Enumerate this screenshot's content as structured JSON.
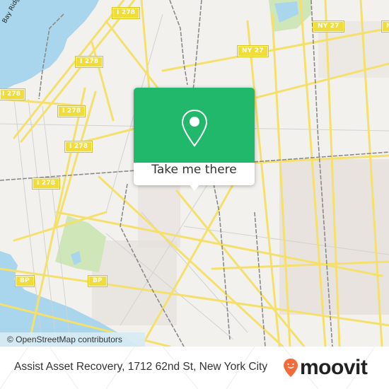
{
  "map": {
    "water_label": "Bay Ridge Channel",
    "shields": [
      {
        "label": "I 278"
      },
      {
        "label": "I 278"
      },
      {
        "label": "I 278"
      },
      {
        "label": "I 278"
      },
      {
        "label": "I 278"
      },
      {
        "label": "I 278"
      },
      {
        "label": "NY 27"
      },
      {
        "label": "NY 27"
      },
      {
        "label": "NY"
      },
      {
        "label": "BP"
      },
      {
        "label": "BP"
      }
    ],
    "attribution": "© OpenStreetMap contributors",
    "colors": {
      "land": "#f2f1ed",
      "water": "#a9d6ec",
      "road": "#f4e06b",
      "park": "#cfe6b8",
      "rail": "#8a8a8a",
      "building": "#e5dfdc"
    }
  },
  "popup": {
    "icon": "location-pin-icon",
    "cta_label": "Take me there",
    "accent": "#22b86b"
  },
  "footer": {
    "address": "Assist Asset Recovery, 1712 62nd St, New York City",
    "brand": "moovit",
    "brand_color": "#f26b3a"
  }
}
